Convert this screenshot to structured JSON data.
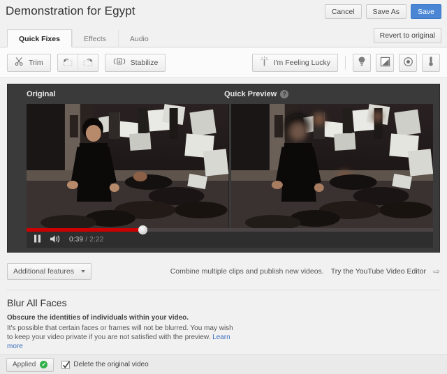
{
  "header": {
    "title": "Demonstration for Egypt",
    "actions": [
      {
        "label": "Cancel",
        "name": "cancel-button",
        "primary": false
      },
      {
        "label": "Save As",
        "name": "save-as-button",
        "primary": false
      },
      {
        "label": "Save",
        "name": "save-button",
        "primary": true
      }
    ],
    "save_button_color": "#4a86d4"
  },
  "tabs": {
    "items": [
      {
        "label": "Quick Fixes",
        "active": true
      },
      {
        "label": "Effects",
        "active": false
      },
      {
        "label": "Audio",
        "active": false
      }
    ],
    "revert_label": "Revert to original"
  },
  "toolbar": {
    "trim_label": "Trim",
    "trim_icon": "scissors-icon",
    "rotate_left_icon": "rotate-left-icon",
    "rotate_right_icon": "rotate-right-icon",
    "stabilize_label": "Stabilize",
    "stabilize_icon": "stabilize-icon",
    "lucky_label": "I'm Feeling Lucky",
    "lucky_icon": "magic-wand-icon",
    "adjust_buttons": [
      {
        "name": "brightness-button",
        "icon": "lightbulb-icon"
      },
      {
        "name": "contrast-button",
        "icon": "contrast-icon"
      },
      {
        "name": "saturation-button",
        "icon": "saturation-icon"
      },
      {
        "name": "color-temperature-button",
        "icon": "thermometer-icon"
      }
    ]
  },
  "preview": {
    "original_label": "Original",
    "quick_preview_label": "Quick Preview",
    "help_glyph": "?",
    "player": {
      "play_state_icon": "pause-icon",
      "volume_icon": "volume-icon",
      "current_time": "0:39",
      "separator": "/",
      "total_time": "2:22",
      "progress_percent": 28.6,
      "progress_color": "#cc0000"
    }
  },
  "features": {
    "dropdown_label": "Additional features",
    "promo_text": "Combine multiple clips and publish new videos.",
    "promo_link": "Try the YouTube Video Editor",
    "promo_arrow_icon": "arrow-right-icon"
  },
  "blur_section": {
    "title": "Blur All Faces",
    "lead": "Obscure the identities of individuals within your video.",
    "body": "It's possible that certain faces or frames will not be blurred. You may wish to keep your video private if you are not satisfied with the preview.",
    "learn_more": "Learn more"
  },
  "bottom_bar": {
    "applied_label": "Applied",
    "applied_check_glyph": "✓",
    "applied_check_color": "#34b14b",
    "delete_original_label": "Delete the original video",
    "delete_original_checked": true
  }
}
